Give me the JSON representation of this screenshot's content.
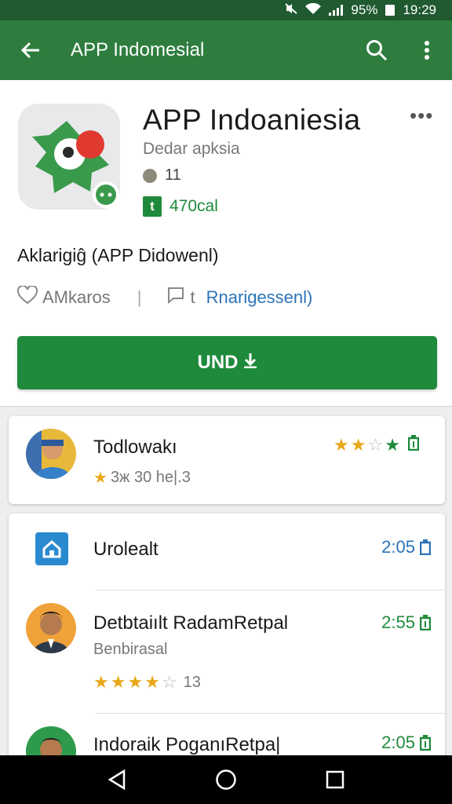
{
  "status_bar": {
    "battery": "95%",
    "time": "19:29"
  },
  "appbar": {
    "back_icon": "arrow-left-icon",
    "title": "APP Indomesial",
    "search_icon": "search-icon",
    "menu_icon": "more-vert-icon"
  },
  "app": {
    "name": "APP Indoaniesia",
    "developer": "Dedar apksia",
    "rating_value": "11",
    "badge_letter": "t",
    "badge_text": "470cal",
    "description": "Aklarigiĝ (APP Didowenl)",
    "wishlist_label": "AMkaros",
    "comment_prefix": "t",
    "comment_link": "Rnarigessenl)",
    "install_label": "UND"
  },
  "reviews": [
    {
      "name": "Todlowakı",
      "meta": "3ж 30 he|.3",
      "stars_filled": 2,
      "stars_total": 4
    }
  ],
  "list": [
    {
      "name": "Urolealt",
      "time": "2:05",
      "icon": "home-icon"
    },
    {
      "name": "Detbtaiılt RadamRetpal",
      "subtitle": "Benbirasal",
      "rating": 4,
      "count": "13",
      "time": "2:55"
    },
    {
      "name": "Indoraik PoganıRetpa|",
      "time": "2:05"
    }
  ],
  "colors": {
    "primary": "#2e7d3e",
    "accent": "#1f8a3c",
    "link": "#2b74b8",
    "star": "#e8a81a"
  }
}
